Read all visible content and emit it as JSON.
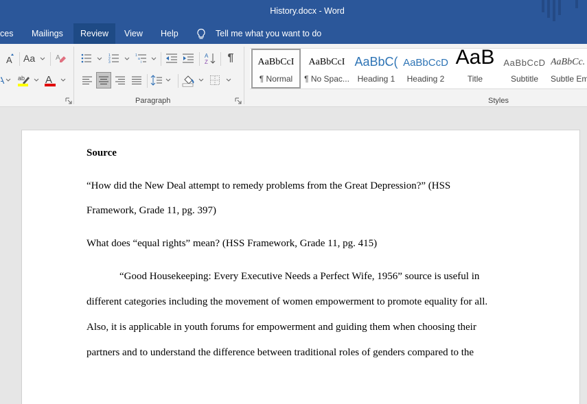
{
  "window": {
    "title": "History.docx  -  Word"
  },
  "tabs": [
    {
      "label": "ces",
      "active": false
    },
    {
      "label": "Mailings",
      "active": false
    },
    {
      "label": "Review",
      "active": true
    },
    {
      "label": "View",
      "active": false
    },
    {
      "label": "Help",
      "active": false
    }
  ],
  "tell_me": {
    "icon": "lightbulb-icon",
    "placeholder": "Tell me what you want to do"
  },
  "ribbon": {
    "font_group": {
      "buttons": [
        {
          "name": "shrink-font",
          "icon": "font-size-icon"
        },
        {
          "name": "change-case",
          "label": "Aa",
          "icon": "change-case-icon"
        },
        {
          "name": "clear-formatting",
          "icon": "eraser-icon"
        },
        {
          "name": "text-effects",
          "icon": "text-effects-icon"
        },
        {
          "name": "highlight-color",
          "icon": "highlighter-icon",
          "color": "#ffff00"
        },
        {
          "name": "font-color",
          "icon": "font-color-icon",
          "color": "#e00000"
        }
      ]
    },
    "paragraph_group": {
      "label": "Paragraph",
      "buttons": [
        {
          "name": "bullets",
          "icon": "bullets-icon"
        },
        {
          "name": "numbering",
          "icon": "numbering-icon"
        },
        {
          "name": "multilevel-list",
          "icon": "multilevel-list-icon"
        },
        {
          "name": "decrease-indent",
          "icon": "decrease-indent-icon"
        },
        {
          "name": "increase-indent",
          "icon": "increase-indent-icon"
        },
        {
          "name": "sort",
          "icon": "sort-az-icon"
        },
        {
          "name": "show-hide",
          "label": "¶",
          "icon": "pilcrow-icon"
        },
        {
          "name": "align-left",
          "icon": "align-left-icon",
          "pressed": false
        },
        {
          "name": "center",
          "icon": "align-center-icon",
          "pressed": true
        },
        {
          "name": "align-right",
          "icon": "align-right-icon",
          "pressed": false
        },
        {
          "name": "justify",
          "icon": "justify-icon",
          "pressed": false
        },
        {
          "name": "line-spacing",
          "icon": "line-spacing-icon"
        },
        {
          "name": "shading",
          "icon": "paint-bucket-icon"
        },
        {
          "name": "borders",
          "icon": "borders-icon"
        }
      ]
    },
    "styles_group": {
      "label": "Styles",
      "items": [
        {
          "preview": "AaBbCcI",
          "name": "¶ Normal",
          "selected": true
        },
        {
          "preview": "AaBbCcI",
          "name": "¶ No Spac...",
          "selected": false
        },
        {
          "preview": "AaBbC(",
          "name": "Heading 1",
          "selected": false
        },
        {
          "preview": "AaBbCcD",
          "name": "Heading 2",
          "selected": false
        },
        {
          "preview": "AaB",
          "name": "Title",
          "selected": false
        },
        {
          "preview": "AaBbCcD",
          "name": "Subtitle",
          "selected": false
        },
        {
          "preview": "AaBbCc.",
          "name": "Subtle Em",
          "selected": false
        }
      ]
    }
  },
  "document": {
    "heading": "Source",
    "para1_lines": [
      "“How did the New Deal attempt to remedy problems from the Great Depression?” (HSS",
      "Framework, Grade 11, pg. 397)"
    ],
    "para2": "What does “equal rights” mean? (HSS Framework, Grade 11, pg. 415)",
    "para3_lines": [
      "“Good Housekeeping: Every Executive Needs a Perfect Wife, 1956” source is useful in",
      "different categories including the movement of women empowerment to promote equality for all.",
      "Also, it is applicable in youth forums for empowerment and guiding them when choosing their",
      "partners and to understand the difference between traditional roles of genders compared to the"
    ]
  }
}
